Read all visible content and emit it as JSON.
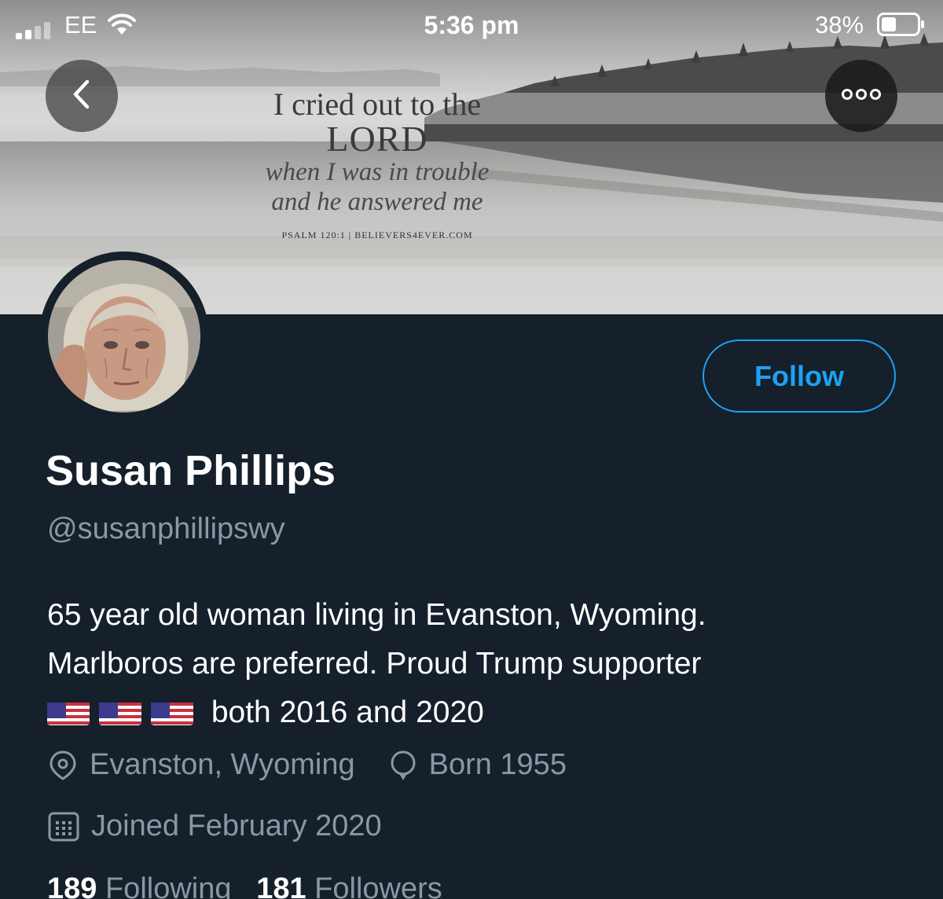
{
  "status_bar": {
    "carrier": "EE",
    "time": "5:36 pm",
    "battery": "38%"
  },
  "banner": {
    "quote_line1": "I cried out to the",
    "quote_line2": "LORD",
    "quote_line3": "when I was in trouble",
    "quote_line4": "and he answered me",
    "source": "PSALM 120:1 | BELIEVERS4EVER.COM"
  },
  "header": {
    "back_icon": "chevron-left-icon",
    "more_icon": "more-dots-icon"
  },
  "profile": {
    "follow_label": "Follow",
    "name": "Susan Phillips",
    "handle": "@susanphillipswy",
    "bio_line1": "65 year old woman living in Evanston, Wyoming.",
    "bio_line2": "Marlboros are preferred. Proud Trump supporter",
    "bio_line3": "both 2016 and 2020",
    "location": "Evanston, Wyoming",
    "birth": "Born 1955",
    "joined": "Joined February 2020",
    "following_count": "189",
    "following_label": "Following",
    "followers_count": "181",
    "followers_label": "Followers"
  },
  "colors": {
    "background": "#15202b",
    "accent": "#1da1f2",
    "muted": "#8899a6"
  }
}
